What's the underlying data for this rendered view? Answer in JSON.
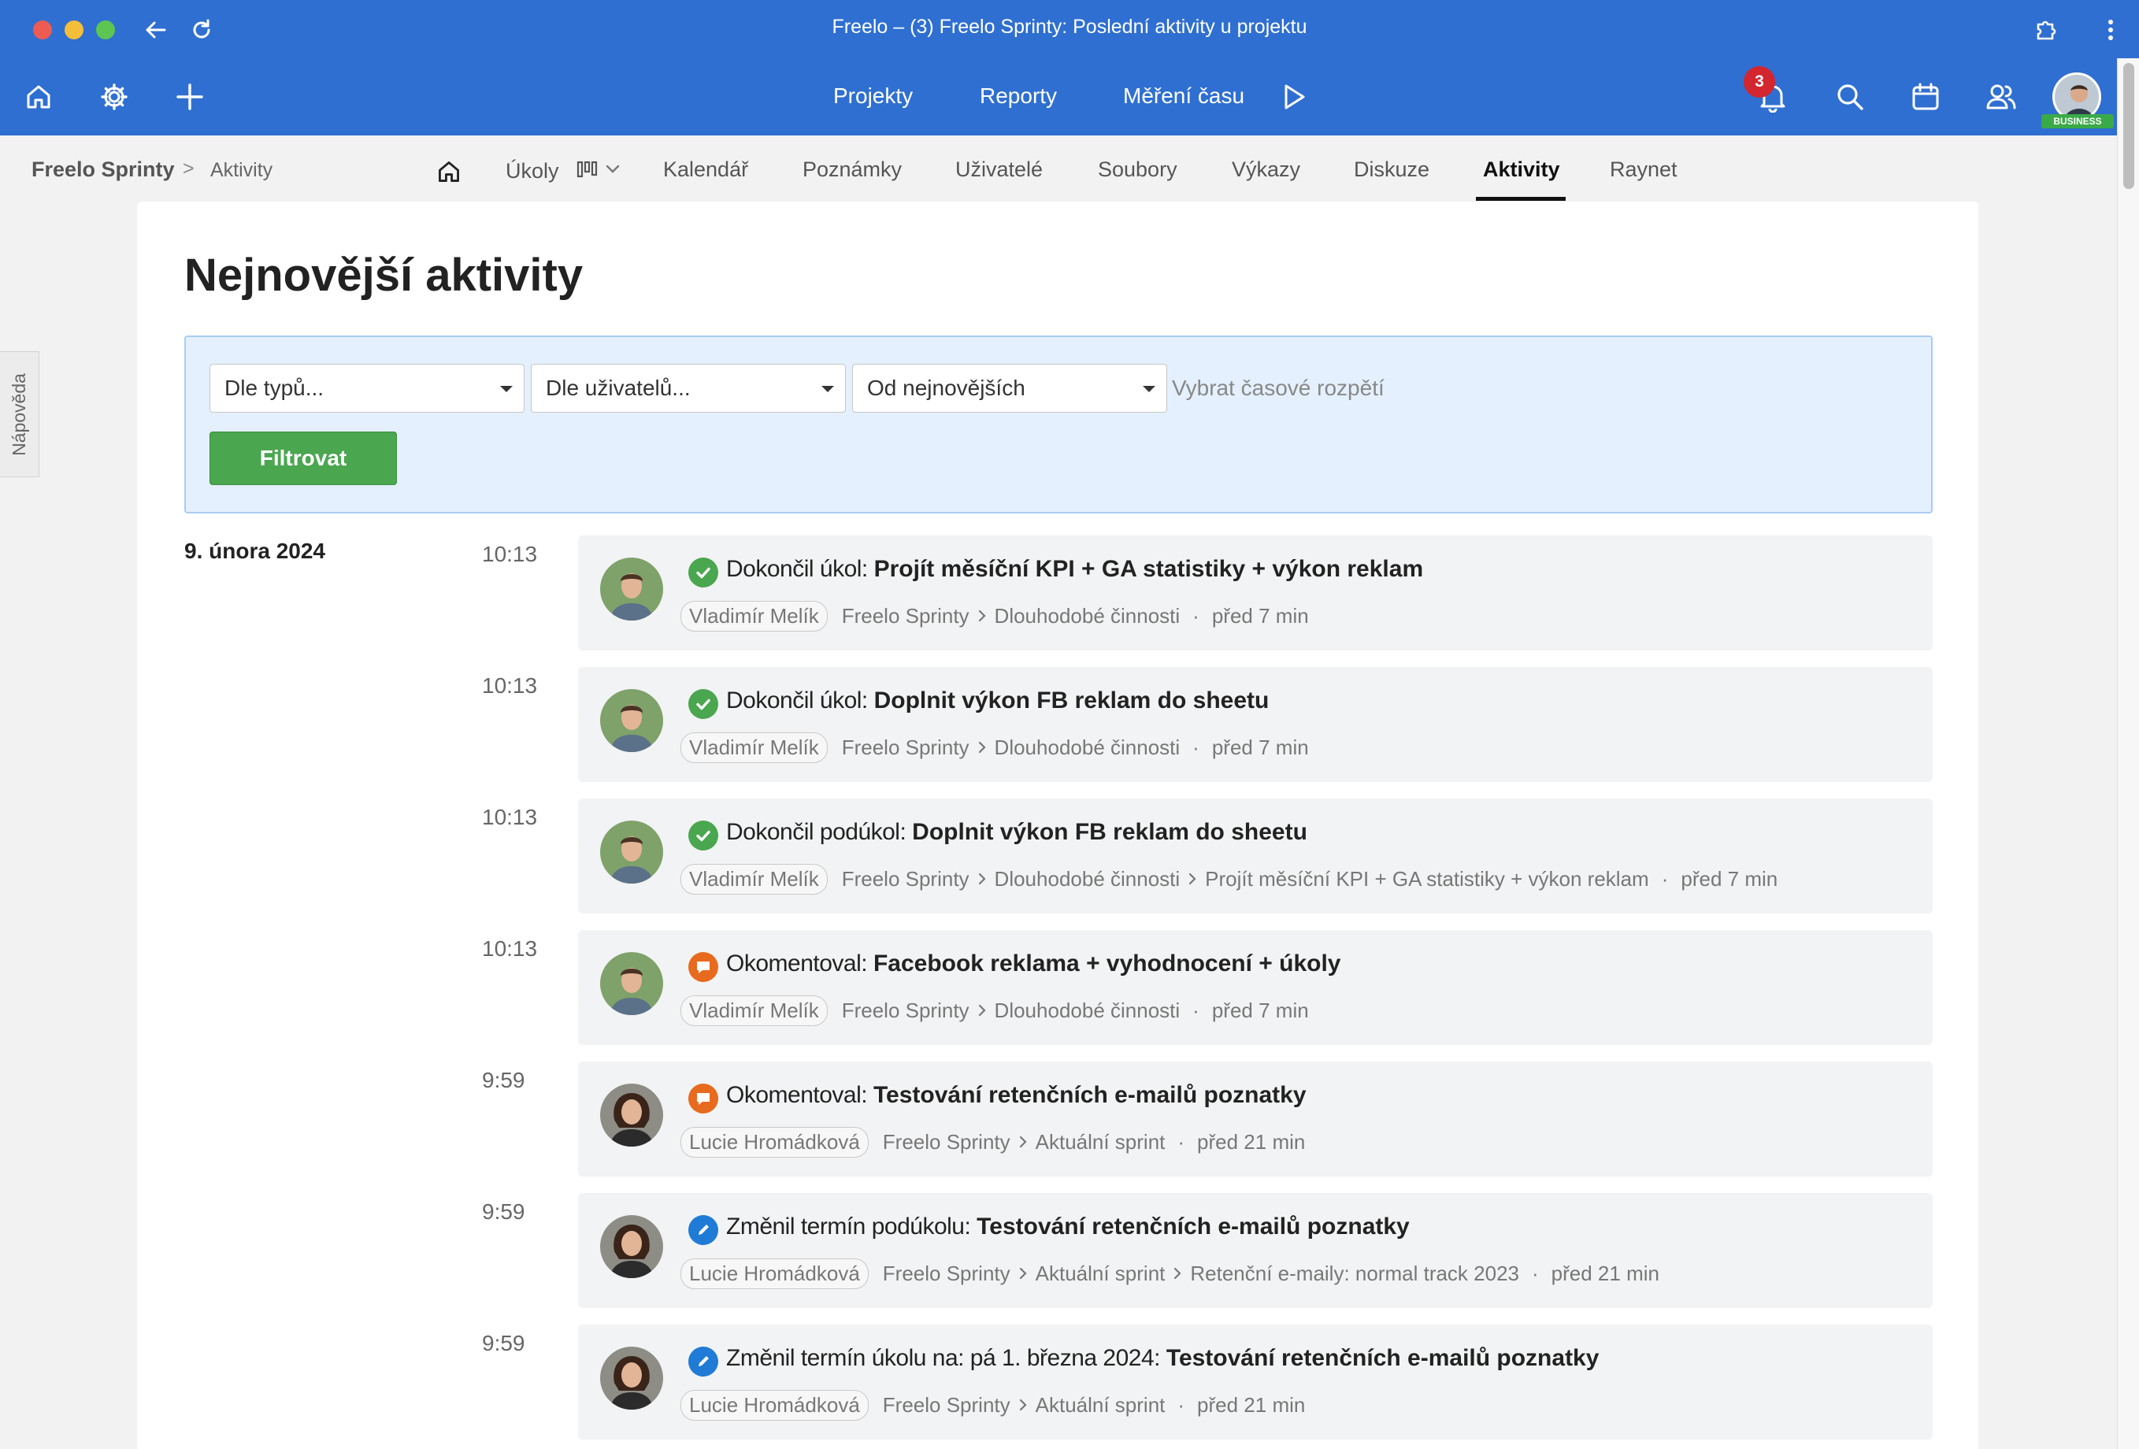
{
  "window": {
    "title": "Freelo – (3) Freelo Sprinty: Poslední aktivity u projektu"
  },
  "appnav": {
    "links": [
      "Projekty",
      "Reporty",
      "Měření času"
    ],
    "notification_count": "3",
    "plan_badge": "BUSINESS"
  },
  "breadcrumb": {
    "project": "Freelo Sprinty",
    "separator": ">",
    "current": "Aktivity"
  },
  "tabs": [
    "Úkoly",
    "Kalendář",
    "Poznámky",
    "Uživatelé",
    "Soubory",
    "Výkazy",
    "Diskuze",
    "Aktivity",
    "Raynet"
  ],
  "help_tab": "Nápověda",
  "page": {
    "title": "Nejnovější aktivity"
  },
  "filters": {
    "type_select": "Dle typů...",
    "user_select": "Dle uživatelů...",
    "order_select": "Od nejnovějších",
    "date_range": "Vybrat časové rozpětí",
    "submit": "Filtrovat"
  },
  "date_group": "9. února 2024",
  "activities": [
    {
      "time": "10:13",
      "status_icon": "check-circle-icon",
      "action": "Dokončil úkol:",
      "subject": "Projít měsíční KPI + GA statistiky + výkon reklam",
      "user": "Vladimír Melík",
      "path": [
        "Freelo Sprinty",
        "Dlouhodobé činnosti"
      ],
      "ago": "před 7 min"
    },
    {
      "time": "10:13",
      "status_icon": "check-circle-icon",
      "action": "Dokončil úkol:",
      "subject": "Doplnit výkon FB reklam do sheetu",
      "user": "Vladimír Melík",
      "path": [
        "Freelo Sprinty",
        "Dlouhodobé činnosti"
      ],
      "ago": "před 7 min"
    },
    {
      "time": "10:13",
      "status_icon": "check-circle-icon",
      "action": "Dokončil podúkol:",
      "subject": "Doplnit výkon FB reklam do sheetu",
      "user": "Vladimír Melík",
      "path": [
        "Freelo Sprinty",
        "Dlouhodobé činnosti",
        "Projít měsíční KPI + GA statistiky + výkon reklam"
      ],
      "ago": "před 7 min"
    },
    {
      "time": "10:13",
      "status_icon": "comment-icon",
      "action": "Okomentoval:",
      "subject": "Facebook reklama + vyhodnocení + úkoly",
      "user": "Vladimír Melík",
      "path": [
        "Freelo Sprinty",
        "Dlouhodobé činnosti"
      ],
      "ago": "před 7 min"
    },
    {
      "time": "9:59",
      "status_icon": "comment-icon",
      "action": "Okomentoval:",
      "subject": "Testování retenčních e-mailů poznatky",
      "user": "Lucie Hromádková",
      "path": [
        "Freelo Sprinty",
        "Aktuální sprint"
      ],
      "ago": "před 21 min"
    },
    {
      "time": "9:59",
      "status_icon": "edit-icon",
      "action": "Změnil termín podúkolu:",
      "subject": "Testování retenčních e-mailů poznatky",
      "user": "Lucie Hromádková",
      "path": [
        "Freelo Sprinty",
        "Aktuální sprint",
        "Retenční e-maily: normal track 2023"
      ],
      "ago": "před 21 min"
    },
    {
      "time": "9:59",
      "status_icon": "edit-icon",
      "action": "Změnil termín úkolu na: pá 1. března 2024:",
      "subject": "Testování retenčních e-mailů poznatky",
      "user": "Lucie Hromádková",
      "path": [
        "Freelo Sprinty",
        "Aktuální sprint"
      ],
      "ago": "před 21 min"
    }
  ],
  "colors": {
    "brand_blue": "#2f6fd1",
    "success_green": "#4aa64f",
    "comment_orange": "#e86a1f",
    "edit_blue": "#1f7bd6"
  }
}
